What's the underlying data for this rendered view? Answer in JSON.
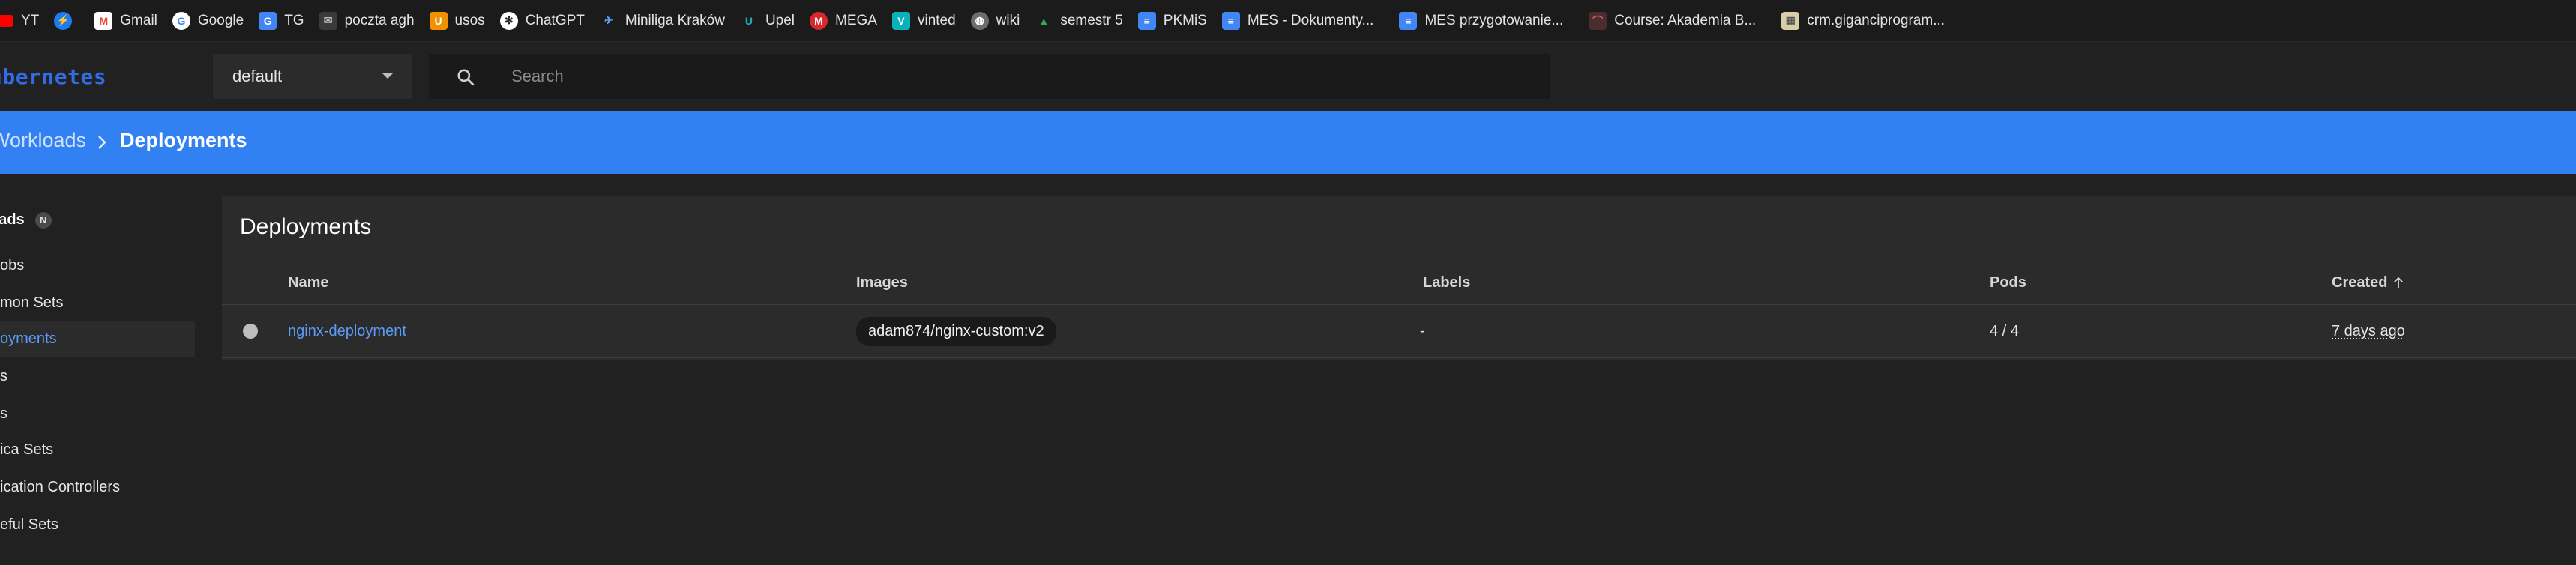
{
  "bookmarks": [
    {
      "label": "YT",
      "icon": "youtube-icon",
      "color": "#ff0000"
    },
    {
      "label": "",
      "icon": "messenger-icon",
      "color": "#1f7bf2"
    },
    {
      "label": "Gmail",
      "icon": "gmail-icon",
      "color": "#ea4335"
    },
    {
      "label": "Google",
      "icon": "google-icon",
      "color": "#4285f4"
    },
    {
      "label": "TG",
      "icon": "translate-icon",
      "color": "#4285f4"
    },
    {
      "label": "poczta agh",
      "icon": "mail-icon",
      "color": "#444444"
    },
    {
      "label": "usos",
      "icon": "usos-icon",
      "color": "#f29100"
    },
    {
      "label": "ChatGPT",
      "icon": "chatgpt-icon",
      "color": "#3a3a3a"
    },
    {
      "label": "Miniliga Kraków",
      "icon": "miniliga-icon",
      "color": "#2f6bd8"
    },
    {
      "label": "Upel",
      "icon": "upel-icon",
      "color": "#1c8f9e"
    },
    {
      "label": "MEGA",
      "icon": "mega-icon",
      "color": "#d9272e"
    },
    {
      "label": "vinted",
      "icon": "vinted-icon",
      "color": "#09b1ba"
    },
    {
      "label": "wiki",
      "icon": "globe-icon",
      "color": "#6d6d6d"
    },
    {
      "label": "semestr 5",
      "icon": "drive-icon",
      "color": "#34a853"
    },
    {
      "label": "PKMiS",
      "icon": "docs-icon",
      "color": "#4285f4"
    },
    {
      "label": "MES - Dokumenty...",
      "icon": "docs-icon",
      "color": "#4285f4"
    },
    {
      "label": "MES przygotowanie...",
      "icon": "docs-icon",
      "color": "#4285f4"
    },
    {
      "label": "Course: Akademia B...",
      "icon": "course-icon",
      "color": "#5a3a3a"
    },
    {
      "label": "crm.giganciprogram...",
      "icon": "crm-icon",
      "color": "#8a7a50"
    }
  ],
  "header": {
    "brand": "ubernetes",
    "namespace": "default",
    "search_placeholder": "Search"
  },
  "breadcrumb": {
    "parent": "Workloads",
    "current": "Deployments"
  },
  "sidebar": {
    "section": "oads",
    "section_badge": "N",
    "items": [
      {
        "label": "Jobs"
      },
      {
        "label": "mon Sets"
      },
      {
        "label": "oyments"
      },
      {
        "label": "s"
      },
      {
        "label": "s"
      },
      {
        "label": "ica Sets"
      },
      {
        "label": "ication Controllers"
      },
      {
        "label": "eful Sets"
      }
    ]
  },
  "main": {
    "title": "Deployments",
    "columns": [
      "Name",
      "Images",
      "Labels",
      "Pods",
      "Created"
    ],
    "rows": [
      {
        "name": "nginx-deployment",
        "image": "adam874/nginx-custom:v2",
        "labels": "-",
        "pods": "4 / 4",
        "created": "7 days ago"
      }
    ]
  },
  "colors": {
    "accent": "#3281f3",
    "link": "#5b9cf7",
    "brand": "#326ce5"
  }
}
